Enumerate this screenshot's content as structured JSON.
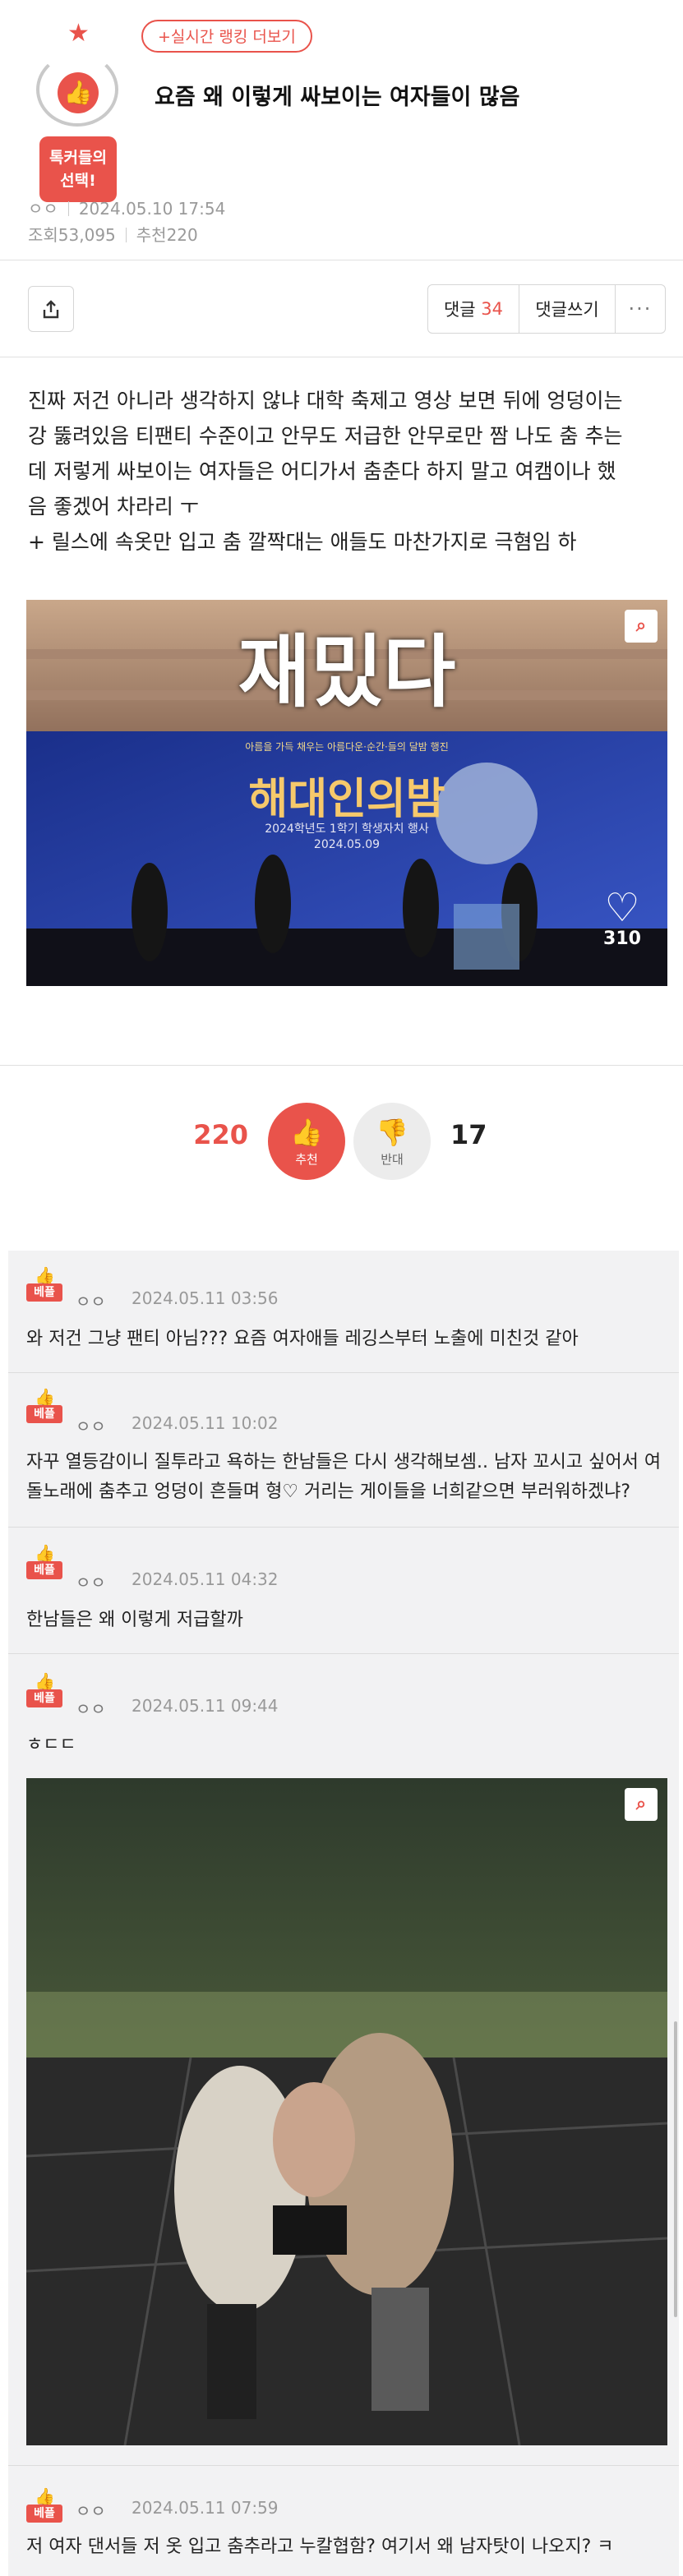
{
  "header": {
    "rank_link": "+실시간 랭킹 더보기",
    "badge_line1": "톡커들의",
    "badge_line2": "선택!",
    "title": "요즘 왜 이렇게 싸보이는 여자들이 많음",
    "author": "ㅇㅇ",
    "date": "2024.05.10 17:54",
    "views": "조회53,095",
    "recommend": "추천220"
  },
  "actions": {
    "share_icon": "share-icon",
    "comments_label": "댓글",
    "comments_count": "34",
    "write_comment": "댓글쓰기",
    "more": "···"
  },
  "post": {
    "lines": [
      "진짜 저건 아니라 생각하지 않냐 대학 축제고 영상 보면 뒤에 엉덩이는",
      "강 뚫려있음 티팬티 수준이고 안무도 저급한 안무로만 짬 나도 춤 추는",
      "데 저렇게 싸보이는 여자들은 어디가서 춤춘다 하지 말고 여캠이나 했",
      "음 좋겠어 차라리 ㅜ",
      "+ 릴스에 속옷만 입고 춤 깔짝대는 애들도 마찬가지로 극혐임 하"
    ],
    "image1": {
      "overlay_text": "재밌다",
      "banner_sub": "아름을 가득 채우는 아름다운·순간·들의 달밤 행진",
      "banner_title": "해대인의밤",
      "banner_date": "2024.05.09",
      "banner_org": "2024학년도 1학기 학생자치 행사",
      "like_count": "310"
    }
  },
  "votes": {
    "up_count": "220",
    "up_label": "추천",
    "down_label": "반대",
    "down_count": "17"
  },
  "comments": [
    {
      "badge": "베플",
      "author": "ㅇㅇ",
      "time": "2024.05.11 03:56",
      "text": [
        "와 저건 그냥 팬티 아님??? 요즘 여자애들 레깅스부터 노출에 미친것 같아"
      ]
    },
    {
      "badge": "베플",
      "author": "ㅇㅇ",
      "time": "2024.05.11 10:02",
      "text": [
        "자꾸 열등감이니 질투라고 욕하는 한남들은 다시 생각해보셈.. 남자 꼬시고 싶어서 여",
        "돌노래에 춤추고 엉덩이 흔들며 형♡ 거리는 게이들을 너희같으면 부러워하겠냐?"
      ]
    },
    {
      "badge": "베플",
      "author": "ㅇㅇ",
      "time": "2024.05.11 04:32",
      "text": [
        "한남들은 왜 이렇게 저급할까"
      ]
    },
    {
      "badge": "베플",
      "author": "ㅇㅇ",
      "time": "2024.05.11 09:44",
      "text": [
        "ㅎㄷㄷ"
      ]
    },
    {
      "badge": "베플",
      "author": "ㅇㅇ",
      "time": "2024.05.11 07:59",
      "text": [
        "저 여자 댄서들 저 옷 입고 춤추라고 누칼협함? 여기서 왜 남자탓이 나오지? ㅋ"
      ]
    }
  ]
}
